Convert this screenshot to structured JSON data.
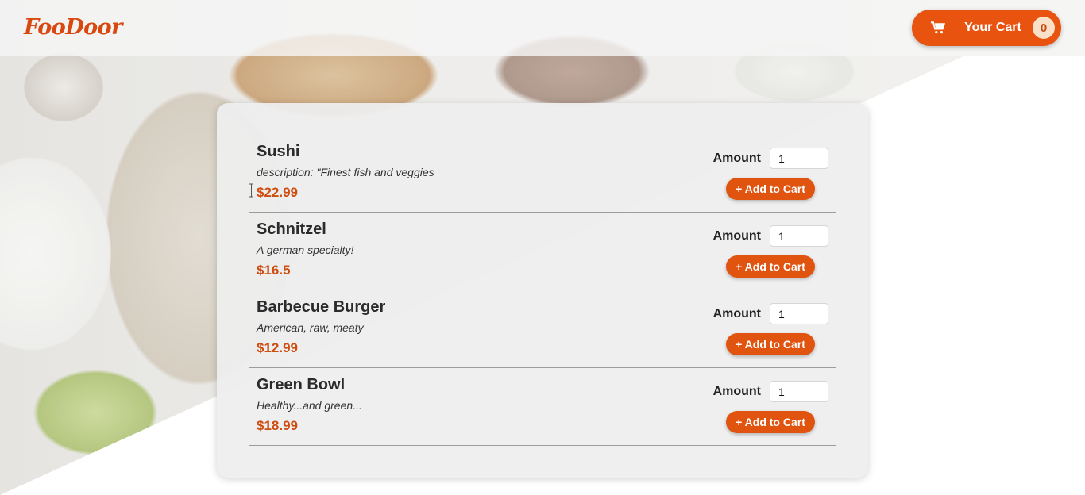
{
  "header": {
    "logo": "FooDoor",
    "cart": {
      "label": "Your Cart",
      "count": "0",
      "icon": "cart-icon"
    }
  },
  "colors": {
    "accent": "#e8540f",
    "price": "#ce4d10",
    "badge_bg": "#fbe0c8"
  },
  "form": {
    "amount_label": "Amount",
    "add_label": "+ Add to Cart"
  },
  "meals": [
    {
      "name": "Sushi",
      "description": "description: \"Finest fish and veggies",
      "price": "$22.99",
      "amount": "1"
    },
    {
      "name": "Schnitzel",
      "description": "A german specialty!",
      "price": "$16.5",
      "amount": "1"
    },
    {
      "name": "Barbecue Burger",
      "description": "American, raw, meaty",
      "price": "$12.99",
      "amount": "1"
    },
    {
      "name": "Green Bowl",
      "description": "Healthy...and green...",
      "price": "$18.99",
      "amount": "1"
    }
  ]
}
